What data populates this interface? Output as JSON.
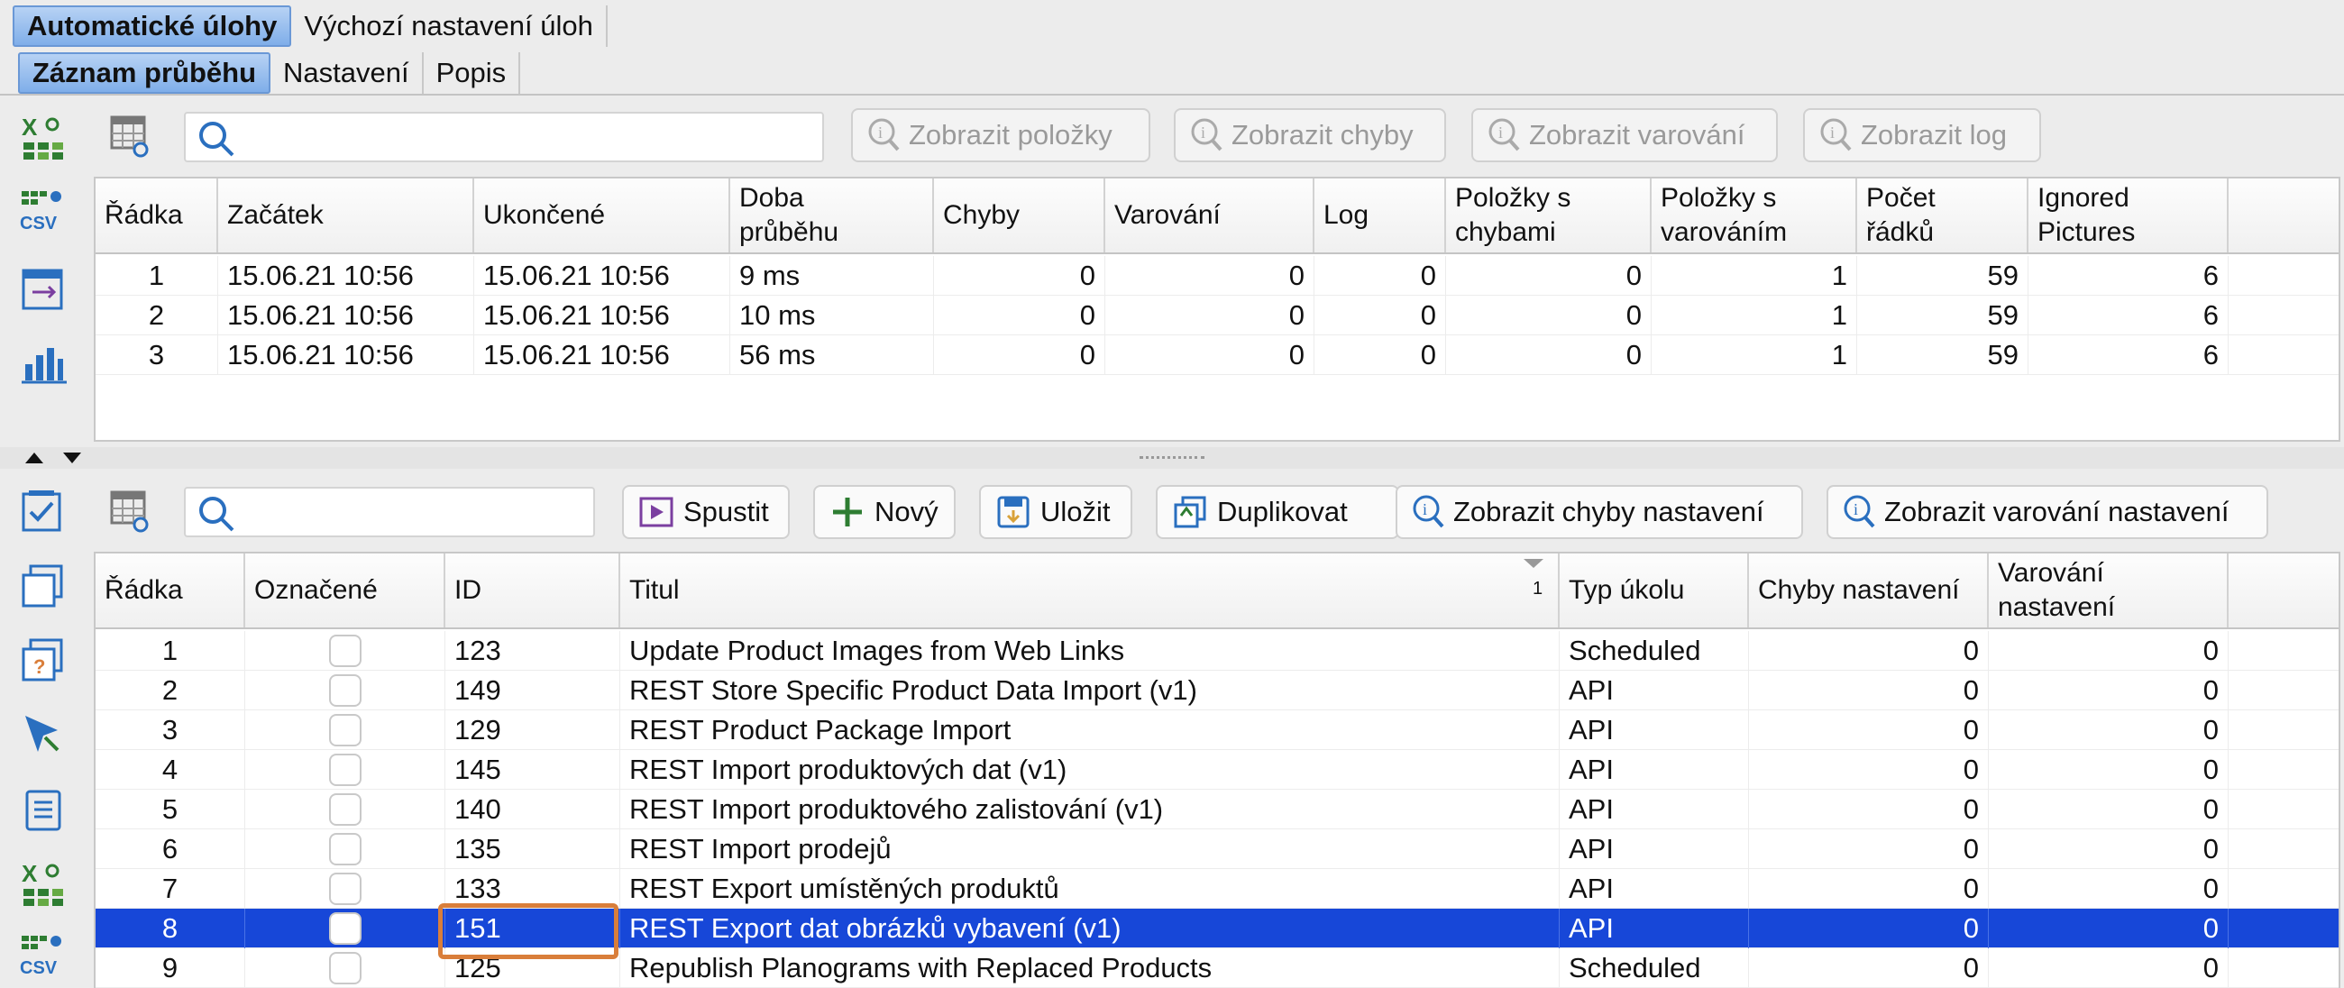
{
  "tabs_main": [
    {
      "label": "Automatické úlohy",
      "active": true
    },
    {
      "label": "Výchozí nastavení úloh",
      "active": false
    }
  ],
  "tabs_sub": [
    {
      "label": "Záznam průběhu",
      "active": true
    },
    {
      "label": "Nastavení",
      "active": false
    },
    {
      "label": "Popis",
      "active": false
    }
  ],
  "top_toolbar": {
    "search_value": "",
    "buttons": [
      "Zobrazit položky",
      "Zobrazit chyby",
      "Zobrazit varování",
      "Zobrazit log"
    ]
  },
  "log_table": {
    "columns": [
      "Řádka",
      "Začátek",
      "Ukončené",
      "Doba\nprůběhu",
      "Chyby",
      "Varování",
      "Log",
      "Položky s\nchybami",
      "Položky s\nvarováním",
      "Počet\nřádků",
      "Ignored\nPictures"
    ],
    "rows": [
      [
        "1",
        "15.06.21 10:56",
        "15.06.21 10:56",
        "9 ms",
        "0",
        "0",
        "0",
        "0",
        "1",
        "59",
        "6"
      ],
      [
        "2",
        "15.06.21 10:56",
        "15.06.21 10:56",
        "10 ms",
        "0",
        "0",
        "0",
        "0",
        "1",
        "59",
        "6"
      ],
      [
        "3",
        "15.06.21 10:56",
        "15.06.21 10:56",
        "56 ms",
        "0",
        "0",
        "0",
        "0",
        "1",
        "59",
        "6"
      ]
    ]
  },
  "bottom_toolbar": {
    "search_value": "",
    "buttons": [
      "Spustit",
      "Nový",
      "Uložit",
      "Duplikovat",
      "Zobrazit chyby nastavení",
      "Zobrazit varování nastavení"
    ]
  },
  "task_table": {
    "columns": [
      "Řádka",
      "Označené",
      "ID",
      "Titul",
      "Typ úkolu",
      "Chyby nastavení",
      "Varování\nnastavení"
    ],
    "sort_indicator": "1",
    "rows": [
      [
        "1",
        "",
        "123",
        "Update Product Images from Web Links",
        "Scheduled",
        "0",
        "0"
      ],
      [
        "2",
        "",
        "149",
        "REST Store Specific Product Data Import (v1)",
        "API",
        "0",
        "0"
      ],
      [
        "3",
        "",
        "129",
        "REST Product Package Import",
        "API",
        "0",
        "0"
      ],
      [
        "4",
        "",
        "145",
        "REST Import produktových dat (v1)",
        "API",
        "0",
        "0"
      ],
      [
        "5",
        "",
        "140",
        "REST Import produktového zalistování (v1)",
        "API",
        "0",
        "0"
      ],
      [
        "6",
        "",
        "135",
        "REST Import prodejů",
        "API",
        "0",
        "0"
      ],
      [
        "7",
        "",
        "133",
        "REST Export umístěných produktů",
        "API",
        "0",
        "0"
      ],
      [
        "8",
        "",
        "151",
        "REST Export dat obrázků vybavení (v1)",
        "API",
        "0",
        "0"
      ],
      [
        "9",
        "",
        "125",
        "Republish Planograms with Replaced Products",
        "Scheduled",
        "0",
        "0"
      ]
    ],
    "selected_row": "8"
  },
  "side_icons_top": [
    "excel-export-icon",
    "csv-export-icon",
    "table-transfer-icon",
    "bar-chart-icon"
  ],
  "side_icons_bottom": [
    "checklist-icon",
    "copy-window-icon",
    "help-window-icon",
    "cursor-select-icon",
    "list-document-icon",
    "excel-export-icon",
    "csv-export-icon"
  ],
  "colors": {
    "selection": "#1747d8",
    "tab_active": "#7faee9",
    "highlight": "#d97e3a"
  }
}
